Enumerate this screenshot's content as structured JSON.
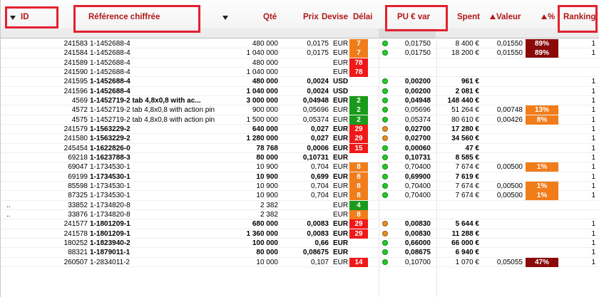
{
  "colors": {
    "header_text": "#b01818",
    "highlight_box": "#e4202f",
    "delai_orange": "#f07c1a",
    "delai_red": "#f01818",
    "delai_green": "#1a9a1a",
    "dot_green": "#22cc22",
    "dot_orange": "#e89020",
    "pct_dark": "#8a0a0a",
    "pct_orange": "#f07c1a"
  },
  "header": {
    "id": "ID",
    "reference": "Référence chiffrée",
    "qte": "Qté",
    "prix": "Prix",
    "devise": "Devise",
    "delai": "Délai",
    "pu_var": "PU € var",
    "spent": "Spent",
    "valeur": "Valeur",
    "pct": "%",
    "ranking": "Ranking"
  },
  "rows": [
    {
      "id": "241583",
      "ref": "1-1452688-4",
      "bold": false,
      "qte": "480 000",
      "prix": "0,0175",
      "dev": "EUR",
      "delai": "7",
      "dcol": "orange",
      "dot": "green",
      "pu": "0,01750",
      "spent": "8 400 €",
      "valeur": "0,01550",
      "pct": "89%",
      "pcol": "dark",
      "rank": "1"
    },
    {
      "id": "241584",
      "ref": "1-1452688-4",
      "bold": false,
      "qte": "1 040 000",
      "prix": "0,0175",
      "dev": "EUR",
      "delai": "7",
      "dcol": "orange",
      "dot": "green",
      "pu": "0,01750",
      "spent": "18 200 €",
      "valeur": "0,01550",
      "pct": "89%",
      "pcol": "dark",
      "rank": "1"
    },
    {
      "id": "241589",
      "ref": "1-1452688-4",
      "bold": false,
      "qte": "480 000",
      "prix": "",
      "dev": "EUR",
      "delai": "78",
      "dcol": "red",
      "dot": "",
      "pu": "",
      "spent": "",
      "valeur": "",
      "pct": "",
      "pcol": "",
      "rank": ""
    },
    {
      "id": "241590",
      "ref": "1-1452688-4",
      "bold": false,
      "qte": "1 040 000",
      "prix": "",
      "dev": "EUR",
      "delai": "78",
      "dcol": "red",
      "dot": "",
      "pu": "",
      "spent": "",
      "valeur": "",
      "pct": "",
      "pcol": "",
      "rank": ""
    },
    {
      "id": "241595",
      "ref": "1-1452688-4",
      "bold": true,
      "qte": "480 000",
      "prix": "0,0024",
      "dev": "USD",
      "delai": "",
      "dcol": "",
      "dot": "green",
      "pu": "0,00200",
      "spent": "961 €",
      "valeur": "",
      "pct": "",
      "pcol": "",
      "rank": "1"
    },
    {
      "id": "241596",
      "ref": "1-1452688-4",
      "bold": true,
      "qte": "1 040 000",
      "prix": "0,0024",
      "dev": "USD",
      "delai": "",
      "dcol": "",
      "dot": "green",
      "pu": "0,00200",
      "spent": "2 081 €",
      "valeur": "",
      "pct": "",
      "pcol": "",
      "rank": "1"
    },
    {
      "id": "4569",
      "ref": "1-1452719-2 tab 4,8x0,8 with ac...",
      "bold": true,
      "qte": "3 000 000",
      "prix": "0,04948",
      "dev": "EUR",
      "delai": "2",
      "dcol": "green",
      "dot": "green",
      "pu": "0,04948",
      "spent": "148 440 €",
      "valeur": "",
      "pct": "",
      "pcol": "",
      "rank": "1"
    },
    {
      "id": "4572",
      "ref": "1-1452719-2 tab 4,8x0,8 with action pin",
      "bold": false,
      "qte": "900 000",
      "prix": "0,05696",
      "dev": "EUR",
      "delai": "2",
      "dcol": "green",
      "dot": "green",
      "pu": "0,05696",
      "spent": "51 264 €",
      "valeur": "0,00748",
      "pct": "13%",
      "pcol": "orange",
      "rank": "1"
    },
    {
      "id": "4575",
      "ref": "1-1452719-2 tab 4,8x0,8 with action pin",
      "bold": false,
      "qte": "1 500 000",
      "prix": "0,05374",
      "dev": "EUR",
      "delai": "2",
      "dcol": "green",
      "dot": "green",
      "pu": "0,05374",
      "spent": "80 610 €",
      "valeur": "0,00426",
      "pct": "8%",
      "pcol": "orange",
      "rank": "1"
    },
    {
      "id": "241579",
      "ref": "1-1563229-2",
      "bold": true,
      "qte": "640 000",
      "prix": "0,027",
      "dev": "EUR",
      "delai": "29",
      "dcol": "red",
      "dot": "orange",
      "pu": "0,02700",
      "spent": "17 280 €",
      "valeur": "",
      "pct": "",
      "pcol": "",
      "rank": "1"
    },
    {
      "id": "241580",
      "ref": "1-1563229-2",
      "bold": true,
      "qte": "1 280 000",
      "prix": "0,027",
      "dev": "EUR",
      "delai": "29",
      "dcol": "red",
      "dot": "orange",
      "pu": "0,02700",
      "spent": "34 560 €",
      "valeur": "",
      "pct": "",
      "pcol": "",
      "rank": "1"
    },
    {
      "id": "245454",
      "ref": "1-1622826-0",
      "bold": true,
      "qte": "78 768",
      "prix": "0,0006",
      "dev": "EUR",
      "delai": "15",
      "dcol": "red",
      "dot": "green",
      "pu": "0,00060",
      "spent": "47 €",
      "valeur": "",
      "pct": "",
      "pcol": "",
      "rank": "1"
    },
    {
      "id": "69218",
      "ref": "1-1623788-3",
      "bold": true,
      "qte": "80 000",
      "prix": "0,10731",
      "dev": "EUR",
      "delai": "",
      "dcol": "",
      "dot": "green",
      "pu": "0,10731",
      "spent": "8 585 €",
      "valeur": "",
      "pct": "",
      "pcol": "",
      "rank": "1"
    },
    {
      "id": "69047",
      "ref": "1-1734530-1",
      "bold": false,
      "qte": "10 900",
      "prix": "0,704",
      "dev": "EUR",
      "delai": "8",
      "dcol": "orange",
      "dot": "green",
      "pu": "0,70400",
      "spent": "7 674 €",
      "valeur": "0,00500",
      "pct": "1%",
      "pcol": "orange",
      "rank": "1"
    },
    {
      "id": "69199",
      "ref": "1-1734530-1",
      "bold": true,
      "qte": "10 900",
      "prix": "0,699",
      "dev": "EUR",
      "delai": "8",
      "dcol": "orange",
      "dot": "green",
      "pu": "0,69900",
      "spent": "7 619 €",
      "valeur": "",
      "pct": "",
      "pcol": "",
      "rank": "1"
    },
    {
      "id": "85598",
      "ref": "1-1734530-1",
      "bold": false,
      "qte": "10 900",
      "prix": "0,704",
      "dev": "EUR",
      "delai": "8",
      "dcol": "orange",
      "dot": "green",
      "pu": "0,70400",
      "spent": "7 674 €",
      "valeur": "0,00500",
      "pct": "1%",
      "pcol": "orange",
      "rank": "1"
    },
    {
      "id": "87325",
      "ref": "1-1734530-1",
      "bold": false,
      "qte": "10 900",
      "prix": "0,704",
      "dev": "EUR",
      "delai": "8",
      "dcol": "orange",
      "dot": "green",
      "pu": "0,70400",
      "spent": "7 674 €",
      "valeur": "0,00500",
      "pct": "1%",
      "pcol": "orange",
      "rank": "1"
    },
    {
      "id": "33852",
      "ref": "1-1734820-8",
      "bold": false,
      "qte": "2 382",
      "prix": "",
      "dev": "EUR",
      "delai": "4",
      "dcol": "green",
      "dot": "",
      "pu": "",
      "spent": "",
      "valeur": "",
      "pct": "",
      "pcol": "",
      "rank": "",
      "lead": ".."
    },
    {
      "id": "33876",
      "ref": "1-1734820-8",
      "bold": false,
      "qte": "2 382",
      "prix": "",
      "dev": "EUR",
      "delai": "8",
      "dcol": "orange",
      "dot": "",
      "pu": "",
      "spent": "",
      "valeur": "",
      "pct": "",
      "pcol": "",
      "rank": "",
      "lead": ".."
    },
    {
      "id": "241577",
      "ref": "1-1801209-1",
      "bold": true,
      "qte": "680 000",
      "prix": "0,0083",
      "dev": "EUR",
      "delai": "29",
      "dcol": "red",
      "dot": "orange",
      "pu": "0,00830",
      "spent": "5 644 €",
      "valeur": "",
      "pct": "",
      "pcol": "",
      "rank": "1"
    },
    {
      "id": "241578",
      "ref": "1-1801209-1",
      "bold": true,
      "qte": "1 360 000",
      "prix": "0,0083",
      "dev": "EUR",
      "delai": "29",
      "dcol": "red",
      "dot": "orange",
      "pu": "0,00830",
      "spent": "11 288 €",
      "valeur": "",
      "pct": "",
      "pcol": "",
      "rank": "1"
    },
    {
      "id": "180252",
      "ref": "1-1823940-2",
      "bold": true,
      "qte": "100 000",
      "prix": "0,66",
      "dev": "EUR",
      "delai": "",
      "dcol": "",
      "dot": "green",
      "pu": "0,66000",
      "spent": "66 000 €",
      "valeur": "",
      "pct": "",
      "pcol": "",
      "rank": "1"
    },
    {
      "id": "88321",
      "ref": "1-1879011-1",
      "bold": true,
      "qte": "80 000",
      "prix": "0,08675",
      "dev": "EUR",
      "delai": "",
      "dcol": "",
      "dot": "green",
      "pu": "0,08675",
      "spent": "6 940 €",
      "valeur": "",
      "pct": "",
      "pcol": "",
      "rank": "1"
    },
    {
      "id": "260507",
      "ref": "1-2834011-2",
      "bold": false,
      "qte": "10 000",
      "prix": "0,107",
      "dev": "EUR",
      "delai": "14",
      "dcol": "red",
      "dot": "green",
      "pu": "0,10700",
      "spent": "1 070 €",
      "valeur": "0,05055",
      "pct": "47%",
      "pcol": "dark",
      "rank": "1"
    }
  ]
}
